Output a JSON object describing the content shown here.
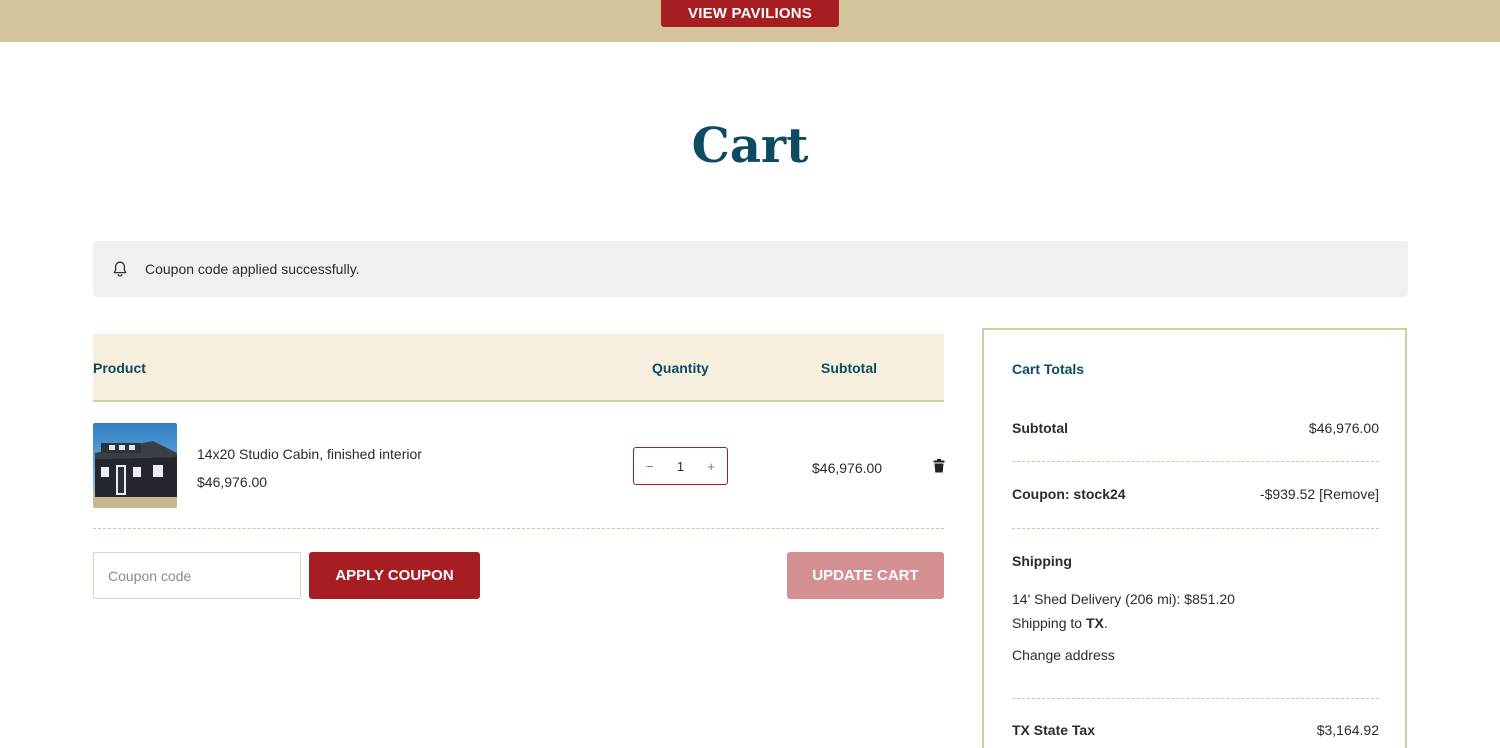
{
  "topbar": {
    "button_label": "VIEW PAVILIONS"
  },
  "page": {
    "title": "Cart"
  },
  "notice": {
    "message": "Coupon code applied successfully."
  },
  "cart_table": {
    "headers": {
      "product": "Product",
      "quantity": "Quantity",
      "subtotal": "Subtotal"
    },
    "items": [
      {
        "name": "14x20 Studio Cabin, finished interior",
        "price": "$46,976.00",
        "quantity": "1",
        "subtotal": "$46,976.00",
        "qty_minus": "−",
        "qty_plus": "+"
      }
    ]
  },
  "actions": {
    "coupon_placeholder": "Coupon code",
    "apply_label": "APPLY COUPON",
    "update_label": "UPDATE CART"
  },
  "totals": {
    "title": "Cart Totals",
    "subtotal_label": "Subtotal",
    "subtotal_value": "$46,976.00",
    "coupon_label": "Coupon: stock24",
    "coupon_value": "-$939.52",
    "coupon_remove": "[Remove]",
    "shipping_label": "Shipping",
    "shipping_method": "14' Shed Delivery (206 mi): $851.20",
    "shipping_to_prefix": "Shipping to ",
    "shipping_to_state": "TX",
    "shipping_to_suffix": ".",
    "change_address": "Change address",
    "tax_label": "TX State Tax",
    "tax_value": "$3,164.92"
  },
  "colors": {
    "brand_red": "#a61e22",
    "heading_blue": "#0d4b63",
    "tan": "#d4c49b",
    "header_bg": "#f6efdd"
  },
  "icons": [
    "bell-icon",
    "trash-icon",
    "product-thumbnail"
  ]
}
